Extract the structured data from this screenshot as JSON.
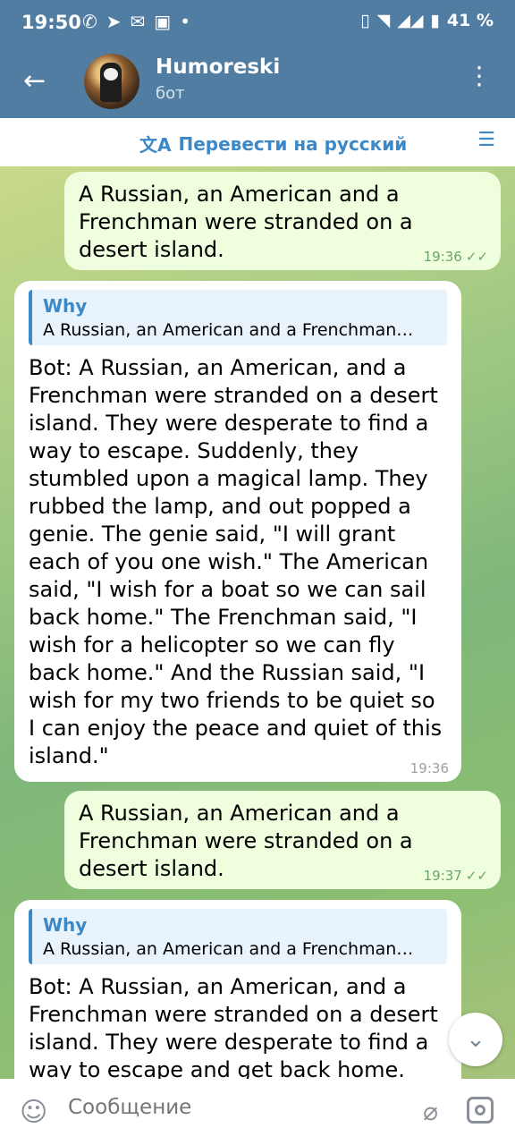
{
  "status_bar": {
    "time": "19:50",
    "battery": "41 %"
  },
  "header": {
    "title": "Humoreski",
    "subtitle": "бот"
  },
  "translate_bar": {
    "label": "Перевести на русский"
  },
  "messages": [
    {
      "text": "A Russian, an American and a Frenchman were stranded on a desert island.",
      "time": "19:36"
    },
    {
      "reply_name": "Why",
      "reply_text": "A Russian, an American and a Frenchman…",
      "text": "Bot: A Russian, an American, and a Frenchman were stranded on a desert island. They were desperate to find a way to escape. Suddenly, they stumbled upon a magical lamp. They rubbed the lamp, and out popped a genie. The genie said, \"I will grant each of you one wish.\" The American said, \"I wish for a boat so we can sail back home.\" The Frenchman said, \"I wish for a helicopter so we can fly back home.\" And the Russian said, \"I wish for my two friends to be quiet so I can enjoy the peace and quiet of this island.\"",
      "time": "19:36"
    },
    {
      "text": "A Russian, an American and a Frenchman were stranded on a desert island.",
      "time": "19:37"
    },
    {
      "reply_name": "Why",
      "reply_text": "A Russian, an American and a Frenchman…",
      "text": "Bot: A Russian, an American, and a Frenchman were stranded on a desert island. They were desperate to find a way to escape and get back home."
    }
  ],
  "input": {
    "placeholder": "Сообщение"
  }
}
